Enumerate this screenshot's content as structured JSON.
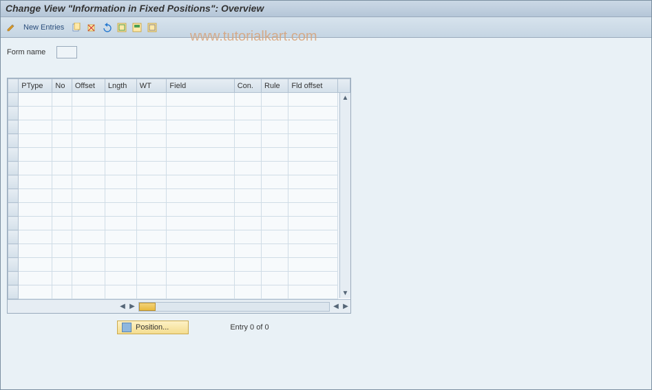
{
  "title": "Change View \"Information in Fixed Positions\": Overview",
  "toolbar": {
    "new_entries": "New Entries"
  },
  "form": {
    "name_label": "Form name",
    "name_value": ""
  },
  "table": {
    "columns": [
      "PType",
      "No",
      "Offset",
      "Lngth",
      "WT",
      "Field",
      "Con.",
      "Rule",
      "Fld offset"
    ],
    "rows": [
      [
        "",
        "",
        "",
        "",
        "",
        "",
        "",
        "",
        ""
      ],
      [
        "",
        "",
        "",
        "",
        "",
        "",
        "",
        "",
        ""
      ],
      [
        "",
        "",
        "",
        "",
        "",
        "",
        "",
        "",
        ""
      ],
      [
        "",
        "",
        "",
        "",
        "",
        "",
        "",
        "",
        ""
      ],
      [
        "",
        "",
        "",
        "",
        "",
        "",
        "",
        "",
        ""
      ],
      [
        "",
        "",
        "",
        "",
        "",
        "",
        "",
        "",
        ""
      ],
      [
        "",
        "",
        "",
        "",
        "",
        "",
        "",
        "",
        ""
      ],
      [
        "",
        "",
        "",
        "",
        "",
        "",
        "",
        "",
        ""
      ],
      [
        "",
        "",
        "",
        "",
        "",
        "",
        "",
        "",
        ""
      ],
      [
        "",
        "",
        "",
        "",
        "",
        "",
        "",
        "",
        ""
      ],
      [
        "",
        "",
        "",
        "",
        "",
        "",
        "",
        "",
        ""
      ],
      [
        "",
        "",
        "",
        "",
        "",
        "",
        "",
        "",
        ""
      ],
      [
        "",
        "",
        "",
        "",
        "",
        "",
        "",
        "",
        ""
      ],
      [
        "",
        "",
        "",
        "",
        "",
        "",
        "",
        "",
        ""
      ],
      [
        "",
        "",
        "",
        "",
        "",
        "",
        "",
        "",
        ""
      ]
    ]
  },
  "footer": {
    "position_label": "Position...",
    "entry_text": "Entry 0 of 0"
  },
  "watermark": "www.tutorialkart.com"
}
